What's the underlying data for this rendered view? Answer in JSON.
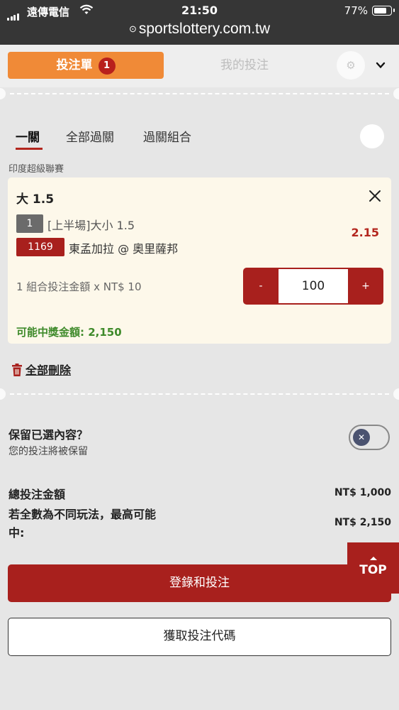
{
  "status_bar": {
    "carrier": "遠傳電信",
    "time": "21:50",
    "battery": "77%",
    "battery_level": 0.77
  },
  "browser": {
    "url": "sportslottery.com.tw"
  },
  "slip_header": {
    "tab_betslip": "投注單",
    "betslip_count": "1",
    "tab_my_bets": "我的投注"
  },
  "bet_tabs": [
    "一關",
    "全部過關",
    "過關組合"
  ],
  "league": "印度超級聯賽",
  "bet": {
    "selection": "大 1.5",
    "line_number": "1",
    "market": "[上半場]大小 1.5",
    "odds": "2.15",
    "match_number": "1169",
    "match": "東孟加拉 @ 奧里薩邦",
    "unit_label": "1 組合投注金額 x NT$ 10",
    "stake": "100",
    "minus": "-",
    "plus": "+",
    "potential_win": "可能中獎金額: 2,150"
  },
  "delete_all": "全部刪除",
  "keep": {
    "title": "保留已選內容？",
    "subtitle": "您的投注將被保留",
    "enabled": false
  },
  "summary": {
    "total_label": "總投注金額",
    "total_value": "NT$ 1,000",
    "max_label_line1": "若全數為不同玩法，最高可能",
    "max_label_line2": "中:",
    "max_value": "NT$ 2,150"
  },
  "buttons": {
    "top": "TOP",
    "login_bet": "登錄和投注",
    "get_code": "獲取投注代碼"
  },
  "colors": {
    "accent_red": "#a8201d",
    "tab_orange": "#f08a37",
    "win_green": "#3e8a2a",
    "status_dark": "#363636"
  }
}
